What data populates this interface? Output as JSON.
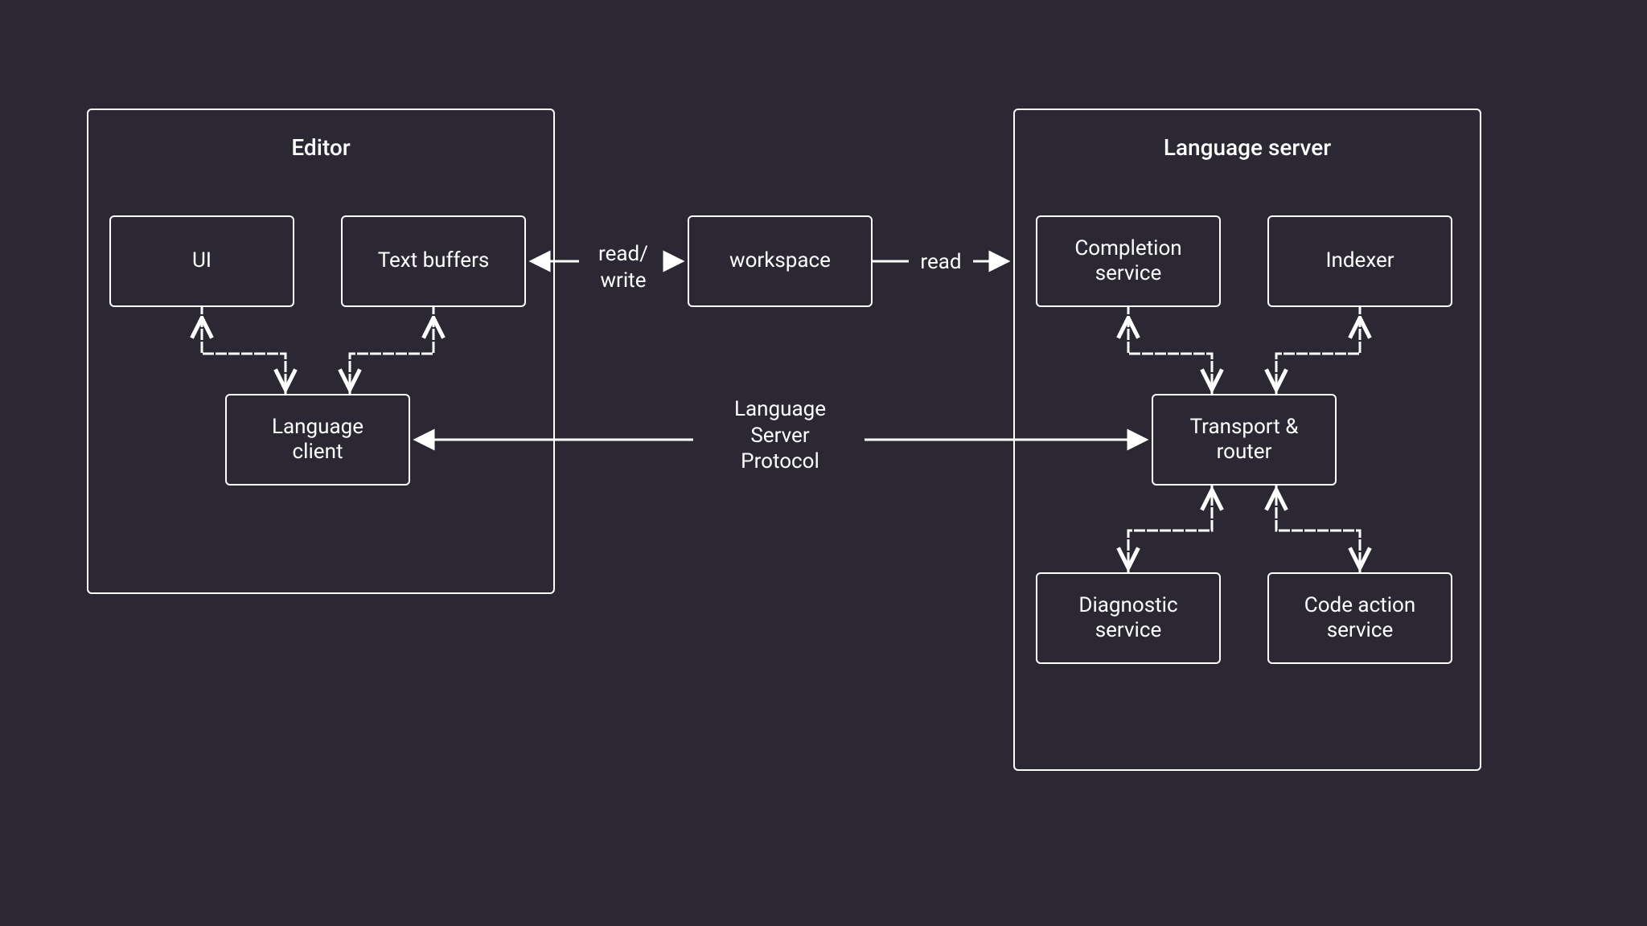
{
  "containers": {
    "editor": {
      "title": "Editor"
    },
    "language_server": {
      "title": "Language server"
    }
  },
  "nodes": {
    "ui": "UI",
    "text_buffers": "Text buffers",
    "language_client": "Language\nclient",
    "workspace": "workspace",
    "completion_service": "Completion\nservice",
    "indexer": "Indexer",
    "transport_router": "Transport &\nrouter",
    "diagnostic_service": "Diagnostic\nservice",
    "code_action_service": "Code action\nservice"
  },
  "edges": {
    "read_write": "read/\nwrite",
    "read": "read",
    "lsp": "Language\nServer\nProtocol"
  },
  "colors": {
    "background": "#2b2834",
    "stroke": "#ffffff"
  }
}
